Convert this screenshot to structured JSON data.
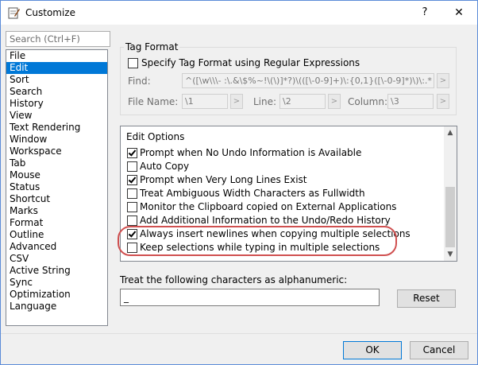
{
  "window": {
    "title": "Customize",
    "help": "?",
    "close": "✕"
  },
  "search": {
    "placeholder": "Search (Ctrl+F)"
  },
  "categories": [
    "File",
    "Edit",
    "Sort",
    "Search",
    "History",
    "View",
    "Text Rendering",
    "Window",
    "Workspace",
    "Tab",
    "Mouse",
    "Status",
    "Shortcut",
    "Marks",
    "Format",
    "Outline",
    "Advanced",
    "CSV",
    "Active String",
    "Sync",
    "Optimization",
    "Language"
  ],
  "selected_category": "Edit",
  "tag_format": {
    "group_label": "Tag Format",
    "specify_label": "Specify Tag Format using Regular Expressions",
    "specify_checked": false,
    "find_label": "Find:",
    "find_value": "^([\\w\\\\\\- :\\.&\\$%~!\\(\\)]*?)\\(([\\-0-9]+)\\:{0,1}([\\-0-9]*)\\)\\:.*",
    "filename_label": "File Name:",
    "filename_value": "\\1",
    "line_label": "Line:",
    "line_value": "\\2",
    "column_label": "Column:",
    "column_value": "\\3",
    "arrow": ">"
  },
  "edit_options": {
    "label": "Edit Options",
    "items": [
      {
        "label": "Prompt when No Undo Information is Available",
        "checked": true
      },
      {
        "label": "Auto Copy",
        "checked": false
      },
      {
        "label": "Prompt when Very Long Lines Exist",
        "checked": true
      },
      {
        "label": "Treat Ambiguous Width Characters as Fullwidth",
        "checked": false
      },
      {
        "label": "Monitor the Clipboard copied on External Applications",
        "checked": false
      },
      {
        "label": "Add Additional Information to the Undo/Redo History",
        "checked": false
      },
      {
        "label": "Always insert newlines when copying multiple selections",
        "checked": true
      },
      {
        "label": "Keep selections while typing in multiple selections",
        "checked": false
      }
    ]
  },
  "alnum": {
    "label": "Treat the following characters as alphanumeric:",
    "value": "_",
    "reset": "Reset"
  },
  "footer": {
    "ok": "OK",
    "cancel": "Cancel"
  },
  "colors": {
    "selection": "#0078d7",
    "highlight": "#d05050"
  }
}
